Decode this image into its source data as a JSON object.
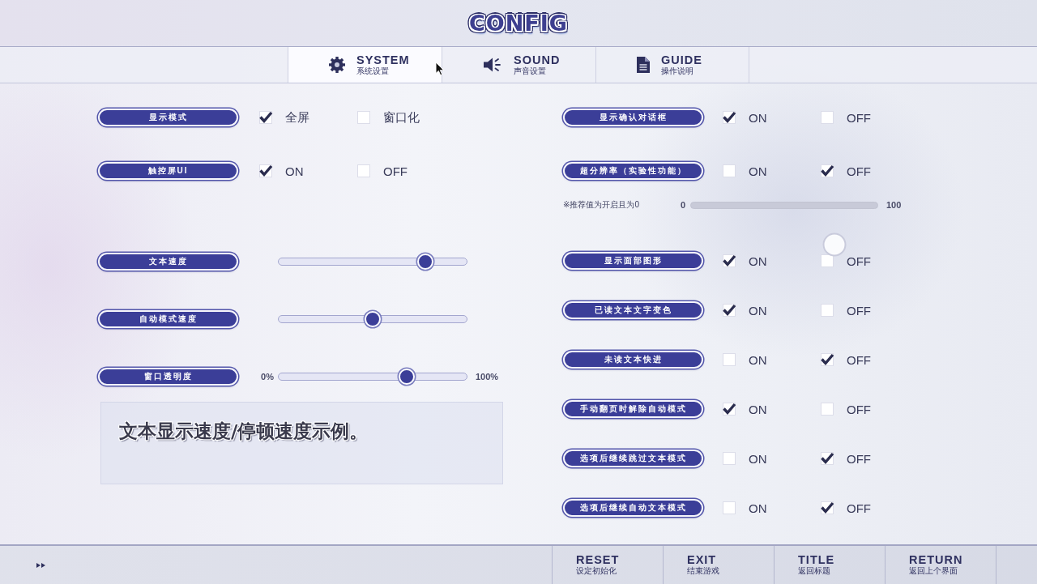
{
  "title": "CONFIG",
  "tabs": [
    {
      "label": "SYSTEM",
      "sublabel": "系统设置",
      "selected": true
    },
    {
      "label": "SOUND",
      "sublabel": "声音设置",
      "selected": false
    },
    {
      "label": "GUIDE",
      "sublabel": "操作说明",
      "selected": false
    }
  ],
  "left_settings": [
    {
      "kind": "choice",
      "label": "显示模式",
      "options": [
        {
          "label": "全屏",
          "checked": true
        },
        {
          "label": "窗口化",
          "checked": false
        }
      ]
    },
    {
      "kind": "choice",
      "label": "触控屏UI",
      "options": [
        {
          "label": "ON",
          "checked": true
        },
        {
          "label": "OFF",
          "checked": false
        }
      ]
    },
    {
      "kind": "slider",
      "label": "文本速度",
      "level": 0.78,
      "disabled": false
    },
    {
      "kind": "slider",
      "label": "自动模式速度",
      "level": 0.5,
      "disabled": false
    },
    {
      "kind": "slider",
      "label": "窗口透明度",
      "min_label": "0%",
      "max_label": "100%",
      "level": 0.68,
      "disabled": false
    }
  ],
  "preview": {
    "text": "文本显示速度/停顿速度示例。"
  },
  "right_settings": [
    {
      "kind": "choice",
      "label": "显示确认对话框",
      "options": [
        {
          "label": "ON",
          "checked": true
        },
        {
          "label": "OFF",
          "checked": false
        }
      ]
    },
    {
      "kind": "choice",
      "label": "超分辨率（实验性功能）",
      "options": [
        {
          "label": "ON",
          "checked": false
        },
        {
          "label": "OFF",
          "checked": true
        }
      ]
    },
    {
      "kind": "range",
      "note": "※推荐值为开启且为0",
      "min_label": "0",
      "max_label": "100",
      "disabled": true
    },
    {
      "kind": "choice",
      "label": "显示面部图形",
      "options": [
        {
          "label": "ON",
          "checked": true
        },
        {
          "label": "OFF",
          "checked": false
        }
      ]
    },
    {
      "kind": "choice",
      "label": "已读文本文字变色",
      "options": [
        {
          "label": "ON",
          "checked": true
        },
        {
          "label": "OFF",
          "checked": false
        }
      ]
    },
    {
      "kind": "choice",
      "label": "未读文本快进",
      "options": [
        {
          "label": "ON",
          "checked": false
        },
        {
          "label": "OFF",
          "checked": true
        }
      ]
    },
    {
      "kind": "choice",
      "label": "手动翻页时解除自动模式",
      "options": [
        {
          "label": "ON",
          "checked": true
        },
        {
          "label": "OFF",
          "checked": false
        }
      ]
    },
    {
      "kind": "choice",
      "label": "选项后继续跳过文本模式",
      "options": [
        {
          "label": "ON",
          "checked": false
        },
        {
          "label": "OFF",
          "checked": true
        }
      ]
    },
    {
      "kind": "choice",
      "label": "选项后继续自动文本模式",
      "options": [
        {
          "label": "ON",
          "checked": false
        },
        {
          "label": "OFF",
          "checked": true
        }
      ]
    }
  ],
  "footer": {
    "buttons": [
      {
        "label": "RESET",
        "sublabel": "设定初始化"
      },
      {
        "label": "EXIT",
        "sublabel": "结束游戏"
      },
      {
        "label": "TITLE",
        "sublabel": "返回标题"
      },
      {
        "label": "RETURN",
        "sublabel": "返回上个界面"
      }
    ]
  }
}
